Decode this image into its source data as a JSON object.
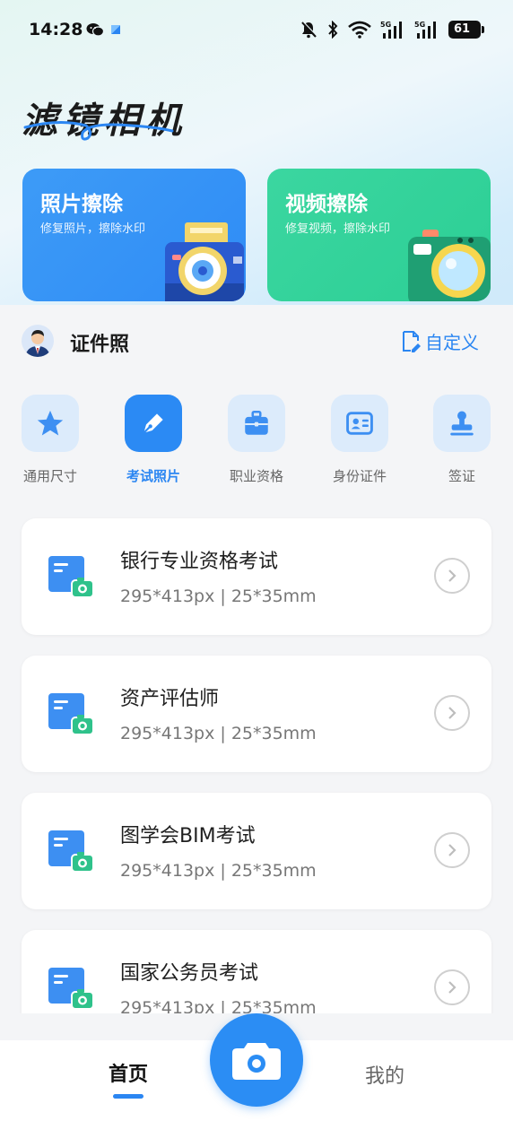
{
  "status_bar": {
    "time": "14:28",
    "battery": "61",
    "icons": [
      "wechat-icon",
      "app-icon",
      "mute-bell-icon",
      "bluetooth-icon",
      "wifi-icon",
      "signal-5g-icon",
      "signal-5g-icon",
      "battery-icon"
    ]
  },
  "app_title": "滤镜相机",
  "feature_cards": [
    {
      "title": "照片擦除",
      "subtitle": "修复照片，擦除水印",
      "color": "#3d9bf7",
      "icon": "camera-illustration"
    },
    {
      "title": "视频擦除",
      "subtitle": "修复视频，擦除水印",
      "color": "#3bd6a0",
      "icon": "video-camera-illustration"
    }
  ],
  "id_photo": {
    "title": "证件照",
    "custom_label": "自定义"
  },
  "categories": [
    {
      "label": "通用尺寸",
      "icon": "star-icon",
      "active": false
    },
    {
      "label": "考试照片",
      "icon": "pen-icon",
      "active": true
    },
    {
      "label": "职业资格",
      "icon": "briefcase-icon",
      "active": false
    },
    {
      "label": "身份证件",
      "icon": "id-card-icon",
      "active": false
    },
    {
      "label": "签证",
      "icon": "stamp-icon",
      "active": false
    }
  ],
  "list_items": [
    {
      "title": "银行专业资格考试",
      "spec": "295*413px | 25*35mm"
    },
    {
      "title": "资产评估师",
      "spec": "295*413px | 25*35mm"
    },
    {
      "title": "图学会BIM考试",
      "spec": "295*413px | 25*35mm"
    },
    {
      "title": "国家公务员考试",
      "spec": "295*413px | 25*35mm"
    }
  ],
  "bottom_nav": {
    "home_label": "首页",
    "mine_label": "我的",
    "accent": "#2b86f2"
  }
}
